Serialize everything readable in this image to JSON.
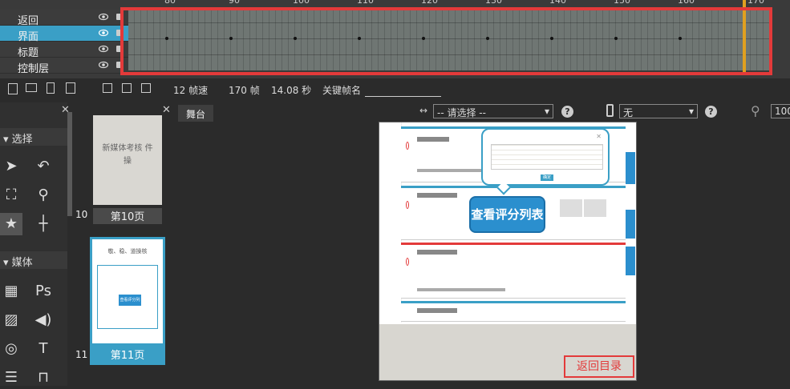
{
  "timeline": {
    "ruler": [
      "80",
      "90",
      "100",
      "110",
      "120",
      "130",
      "140",
      "150",
      "160",
      "170"
    ],
    "layers": [
      {
        "name": "返回",
        "active": false
      },
      {
        "name": "界面",
        "active": true
      },
      {
        "name": "标题",
        "active": false
      },
      {
        "name": "控制层",
        "active": false
      }
    ]
  },
  "infobar": {
    "fps": "12 帧速",
    "frames": "170 帧",
    "seconds": "14.08 秒",
    "keyframe_name_label": "关键帧名"
  },
  "tools": {
    "select_section": "选择",
    "media_section": "媒体",
    "ps_label": "Ps",
    "text_label": "T"
  },
  "pages": {
    "thumb10_text": "新媒体考核 件操",
    "page10_num": "10",
    "page10_label": "第10页",
    "thumb11_title": "敬、稳、道操核",
    "thumb11_callout": "查看评分列表",
    "page11_num": "11",
    "page11_label": "第11页"
  },
  "stage": {
    "tab": "舞台",
    "select1": "-- 请选择 --",
    "select2": "无",
    "help": "?",
    "zoom": "100"
  },
  "canvas": {
    "callout": "查看评分列表",
    "back_button": "返回目录",
    "popup_btn": "确定"
  },
  "colors": {
    "accent": "#3a9fc6",
    "highlight": "#e33a3a",
    "callout": "#2b8fce"
  }
}
